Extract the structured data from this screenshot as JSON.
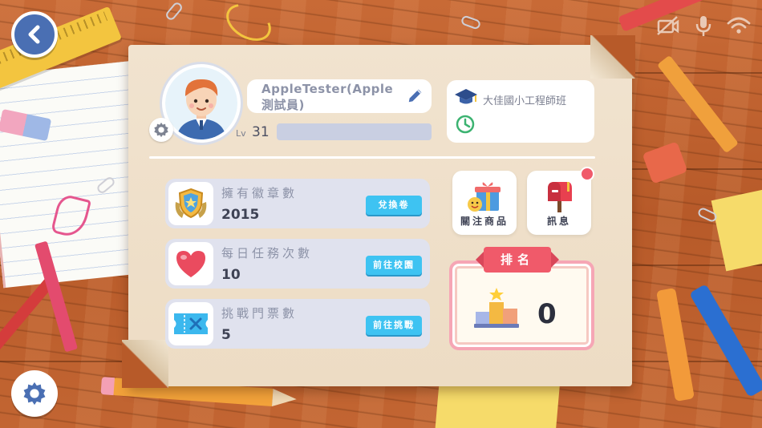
{
  "profile": {
    "name": "AppleTester(Apple測試員)",
    "level_label": "Lv",
    "level": "31",
    "class_name": "大佳國小工程師班"
  },
  "stats": [
    {
      "label": "擁有徽章數",
      "value": "2015",
      "button": "兌換卷",
      "icon": "badge-shield-icon"
    },
    {
      "label": "每日任務次數",
      "value": "10",
      "button": "前往校園",
      "icon": "heart-icon"
    },
    {
      "label": "挑戰門票數",
      "value": "5",
      "button": "前往挑戰",
      "icon": "ticket-icon"
    }
  ],
  "tiles": {
    "wishlist_label": "關注商品",
    "messages_label": "訊息"
  },
  "ranking": {
    "title": "排名",
    "value": "0"
  },
  "status_icons": [
    "camera-off-icon",
    "microphone-icon",
    "wifi-icon"
  ],
  "colors": {
    "accent_blue": "#3ec3f2",
    "back_button": "#4a6fb3",
    "ranking_red": "#f05a6a",
    "panel": "#f1e3cf"
  }
}
